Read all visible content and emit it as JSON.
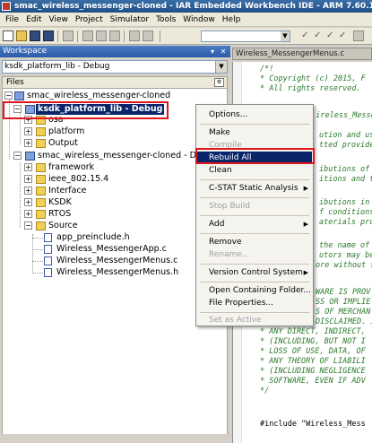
{
  "window": {
    "title": "smac_wireless_messenger-cloned - IAR Embedded Workbench IDE - ARM 7.60.1"
  },
  "menu": [
    "File",
    "Edit",
    "View",
    "Project",
    "Simulator",
    "Tools",
    "Window",
    "Help"
  ],
  "toolbar": {
    "search_value": ""
  },
  "workspace": {
    "header": "Workspace",
    "config": "ksdk_platform_lib - Debug",
    "files_header": "Files"
  },
  "tree": {
    "root": "smac_wireless_messenger-cloned",
    "lib": "ksdk_platform_lib - Debug",
    "lib_children": [
      "osa",
      "platform",
      "Output"
    ],
    "app": "smac_wireless_messenger-cloned - D",
    "app_children": [
      "framework",
      "ieee_802.15.4",
      "Interface",
      "KSDK",
      "RTOS",
      "Source"
    ],
    "source_files": [
      "app_preinclude.h",
      "Wireless_MessengerApp.c",
      "Wireless_MessengerMenus.c",
      "Wireless_MessengerMenus.h"
    ]
  },
  "editor": {
    "tab": "Wireless_MessengerMenus.c",
    "lines": [
      "/*!",
      "* Copyright (c) 2015, F",
      "* All rights reserved.",
      "",
      "* ireless_Messenger",
      "",
      "ution and us",
      "tted provide",
      "",
      "ibutions of",
      "itions and t",
      "",
      "ibutions in",
      "f conditions",
      "aterials pro",
      "",
      "the name of",
      "utors may be",
      "ore without sp",
      "",
      "WARE IS PROV",
      "SS OR IMPLIE",
      "S OF MERCHAN",
      "DISCLAIMED. IN NO EV",
      "* ANY DIRECT, INDIRECT,",
      "* (INCLUDING, BUT NOT I",
      "* LOSS OF USE, DATA, OF",
      "* ANY THEORY OF LIABILI",
      "* (INCLUDING NEGLIGENCE",
      "* SOFTWARE, EVEN IF ADV",
      "*/",
      "",
      "",
      "#include \"Wireless_Mess"
    ]
  },
  "context_menu": {
    "options": "Options...",
    "make": "Make",
    "compile": "Compile",
    "rebuild": "Rebuild All",
    "clean": "Clean",
    "cstat": "C-STAT Static Analysis",
    "stop": "Stop Build",
    "add": "Add",
    "remove": "Remove",
    "rename": "Rename...",
    "vcs": "Version Control System",
    "open_folder": "Open Containing Folder...",
    "file_props": "File Properties...",
    "set_active": "Set as Active"
  }
}
